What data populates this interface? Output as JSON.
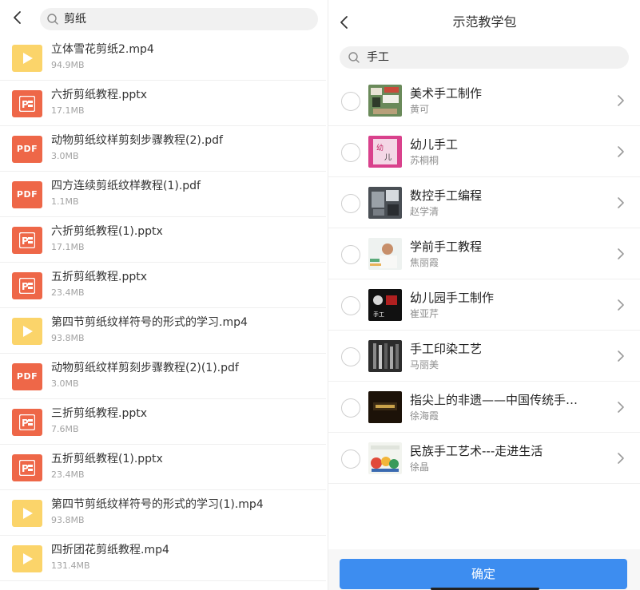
{
  "left": {
    "search": {
      "value": "剪纸"
    },
    "files": [
      {
        "type": "video",
        "name": "立体雪花剪纸2.mp4",
        "size": "94.9MB"
      },
      {
        "type": "ppt",
        "name": "六折剪纸教程.pptx",
        "size": "17.1MB"
      },
      {
        "type": "pdf",
        "name": "动物剪纸纹样剪刻步骤教程(2).pdf",
        "size": "3.0MB"
      },
      {
        "type": "pdf",
        "name": "四方连续剪纸纹样教程(1).pdf",
        "size": "1.1MB"
      },
      {
        "type": "ppt",
        "name": "六折剪纸教程(1).pptx",
        "size": "17.1MB"
      },
      {
        "type": "ppt",
        "name": "五折剪纸教程.pptx",
        "size": "23.4MB"
      },
      {
        "type": "video",
        "name": "第四节剪纸纹样符号的形式的学习.mp4",
        "size": "93.8MB"
      },
      {
        "type": "pdf",
        "name": "动物剪纸纹样剪刻步骤教程(2)(1).pdf",
        "size": "3.0MB"
      },
      {
        "type": "ppt",
        "name": "三折剪纸教程.pptx",
        "size": "7.6MB"
      },
      {
        "type": "ppt",
        "name": "五折剪纸教程(1).pptx",
        "size": "23.4MB"
      },
      {
        "type": "video",
        "name": "第四节剪纸纹样符号的形式的学习(1).mp4",
        "size": "93.8MB"
      },
      {
        "type": "video",
        "name": "四折团花剪纸教程.mp4",
        "size": "131.4MB"
      }
    ],
    "pdf_label": "PDF"
  },
  "right": {
    "title": "示范教学包",
    "search": {
      "value": "手工"
    },
    "packs": [
      {
        "title": "美术手工制作",
        "author": "黄可"
      },
      {
        "title": "幼儿手工",
        "author": "苏桐桐"
      },
      {
        "title": "数控手工编程",
        "author": "赵学清"
      },
      {
        "title": "学前手工教程",
        "author": "焦丽霞"
      },
      {
        "title": "幼儿园手工制作",
        "author": "崔亚芹"
      },
      {
        "title": "手工印染工艺",
        "author": "马丽美"
      },
      {
        "title": "指尖上的非遗——中国传统手…",
        "author": "徐海霞"
      },
      {
        "title": "民族手工艺术---走进生活",
        "author": "徐晶"
      }
    ],
    "confirm_label": "确定"
  },
  "colors": {
    "accent": "#3d8df0",
    "video_icon": "#fbd46a",
    "doc_icon": "#ee6748"
  }
}
